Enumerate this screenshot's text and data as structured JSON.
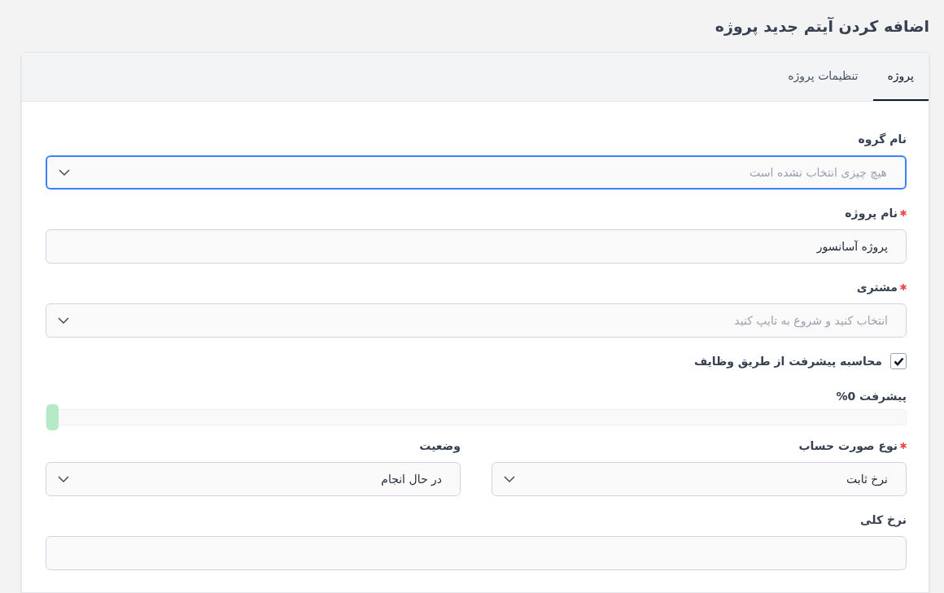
{
  "title": "اضافه کردن آیتم جدید پروژه",
  "tabs": [
    {
      "label": "پروژه",
      "selected": true
    },
    {
      "label": "تنظیمات پروژه",
      "selected": false
    }
  ],
  "form": [
    {
      "kind": "select",
      "label": "نام گروه",
      "required": false,
      "focused": true,
      "placeholder": "هیچ چیزی انتخاب نشده است"
    },
    {
      "kind": "text",
      "label": "نام پروژه",
      "required": true,
      "value": "پروژه آسانسور"
    },
    {
      "kind": "select",
      "label": "مشتری",
      "required": true,
      "placeholder": "انتخاب کنید و شروع به تایپ کنید"
    },
    {
      "kind": "checkbox",
      "label": "محاسبه پیشرفت از طریق وظایف",
      "checked": true
    },
    {
      "kind": "progress",
      "label": "پیشرفت 0%",
      "level": 0
    },
    {
      "kind": "pair",
      "items": [
        {
          "kind": "select",
          "label": "نوع صورت حساب",
          "required": true,
          "value": "نرخ ثابت"
        },
        {
          "kind": "select",
          "label": "وضعیت",
          "required": false,
          "value": "در حال انجام"
        }
      ]
    },
    {
      "kind": "text",
      "label": "نرخ کلی",
      "required": false
    }
  ]
}
